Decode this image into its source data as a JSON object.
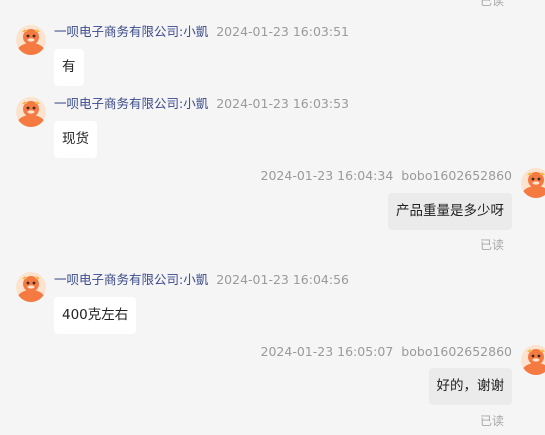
{
  "top_read_status": "已读",
  "messages": [
    {
      "sender": "一呗电子商务有限公司:小凱",
      "time": "2024-01-23 16:03:51",
      "text": "有",
      "avatar": "shop-mascot-avatar"
    },
    {
      "sender": "一呗电子商务有限公司:小凱",
      "time": "2024-01-23 16:03:53",
      "text": "现货",
      "avatar": "shop-mascot-avatar"
    },
    {
      "sender": "bobo1602652860",
      "time": "2024-01-23 16:04:34",
      "text": "产品重量是多少呀",
      "status": "已读",
      "avatar": "user-avatar"
    },
    {
      "sender": "一呗电子商务有限公司:小凱",
      "time": "2024-01-23 16:04:56",
      "text": "400克左右",
      "avatar": "shop-mascot-avatar"
    },
    {
      "sender": "bobo1602652860",
      "time": "2024-01-23 16:05:07",
      "text": "好的，谢谢",
      "status": "已读",
      "avatar": "user-avatar"
    }
  ],
  "colors": {
    "background": "#f5f5f5",
    "incoming_bubble": "#ffffff",
    "outgoing_bubble": "#ebebeb",
    "sender_name": "#3a4a8a",
    "timestamp": "#9a9a9a",
    "avatar_orange": "#f47a42"
  }
}
